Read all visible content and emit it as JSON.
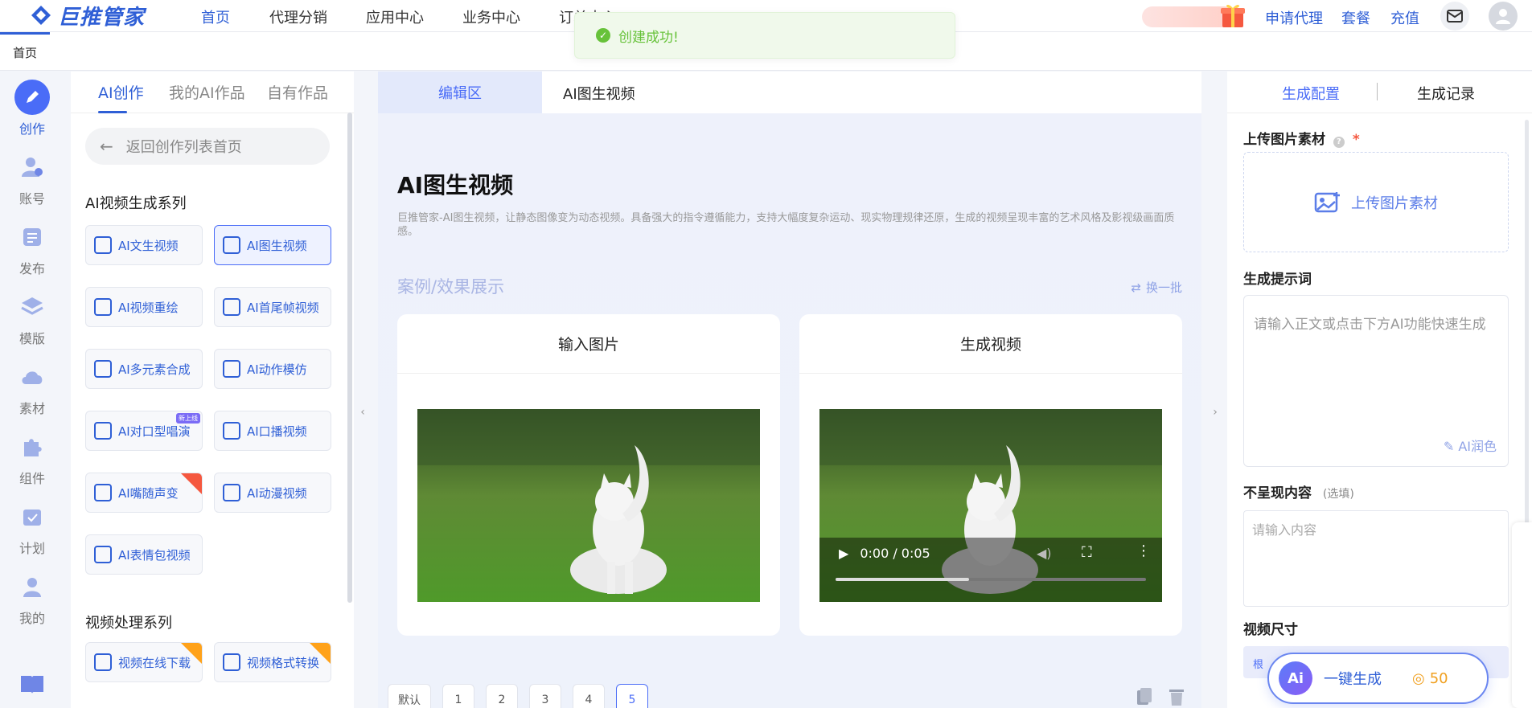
{
  "brand": {
    "logo_text": "巨推管家"
  },
  "topnav": {
    "items": [
      "首页",
      "代理分销",
      "应用中心",
      "业务中心",
      "订单中心"
    ],
    "links": [
      "申请代理",
      "套餐",
      "充值"
    ]
  },
  "tabbar": {
    "home": "首页"
  },
  "toast": {
    "message": "创建成功!"
  },
  "rail": {
    "items": [
      "创作",
      "账号",
      "发布",
      "模版",
      "素材",
      "组件",
      "计划",
      "我的",
      "教程"
    ]
  },
  "category_panel": {
    "tabs": [
      "AI创作",
      "我的AI作品",
      "自有作品"
    ],
    "back_label": "返回创作列表首页",
    "section_ai": "AI视频生成系列",
    "ai_items": [
      "AI文生视频",
      "AI图生视频",
      "AI视频重绘",
      "AI首尾帧视频",
      "AI多元素合成",
      "AI动作模仿",
      "AI对口型唱演",
      "AI口播视频",
      "AI嘴随声变",
      "AI动漫视频",
      "AI表情包视频"
    ],
    "section_process": "视频处理系列",
    "process_items": [
      "视频在线下载",
      "视频格式转换"
    ],
    "tag_new": "新上线"
  },
  "main": {
    "tabs": [
      "编辑区",
      "AI图生视频"
    ],
    "title": "AI图生视频",
    "description": "巨推管家-AI图生视频，让静态图像变为动态视频。具备强大的指令遵循能力，支持大幅度复杂运动、现实物理规律还原，生成的视频呈现丰富的艺术风格及影视级画面质感。",
    "showcase_title": "案例/效果展示",
    "refresh_label": "换一批",
    "input_card": "输入图片",
    "output_card": "生成视频",
    "video_time": "0:00 / 0:05",
    "pager": [
      "默认",
      "1",
      "2",
      "3",
      "4",
      "5"
    ],
    "pager_active": "5"
  },
  "right": {
    "tabs": [
      "生成配置",
      "生成记录"
    ],
    "upload_label": "上传图片素材",
    "upload_button": "上传图片素材",
    "prompt_label": "生成提示词",
    "prompt_placeholder": "请输入正文或点击下方AI功能快速生成",
    "ai_polish": "AI润色",
    "negative_label": "不呈现内容",
    "negative_hint": "(选填)",
    "negative_placeholder": "请输入内容",
    "size_label": "视频尺寸",
    "size_value_partial": "根"
  },
  "generate": {
    "label": "一键生成",
    "cost": "50",
    "ai_badge": "Ai"
  },
  "colors": {
    "accent": "#2f5fd6",
    "primary": "#4a6cf7",
    "success": "#67c23a"
  }
}
